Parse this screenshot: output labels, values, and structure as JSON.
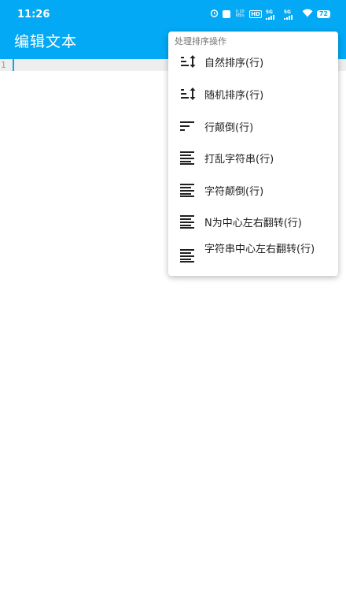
{
  "status_bar": {
    "time": "11:26",
    "speed_value": "0.10",
    "speed_unit": "KB/s",
    "hd_label": "HD",
    "signal1": "5G",
    "signal2": "5G",
    "battery": "72"
  },
  "app_bar": {
    "title": "编辑文本"
  },
  "editor": {
    "line_number": "1"
  },
  "menu": {
    "header": "处理排序操作",
    "items": [
      {
        "label": "自然排序(行)",
        "icon": "sort-arrows-icon"
      },
      {
        "label": "随机排序(行)",
        "icon": "sort-arrows-icon"
      },
      {
        "label": "行颠倒(行)",
        "icon": "short-lines-icon"
      },
      {
        "label": "打乱字符串(行)",
        "icon": "align-lines-icon"
      },
      {
        "label": "字符颠倒(行)",
        "icon": "align-lines-icon"
      },
      {
        "label": "N为中心左右翻转(行)",
        "icon": "align-lines-icon"
      },
      {
        "label": "字符串中心左右翻转(行)",
        "icon": "align-lines-icon"
      }
    ]
  },
  "colors": {
    "primary": "#03a9f4",
    "menu_background": "#ffffff",
    "editor_line_highlight": "#eeeeee"
  }
}
